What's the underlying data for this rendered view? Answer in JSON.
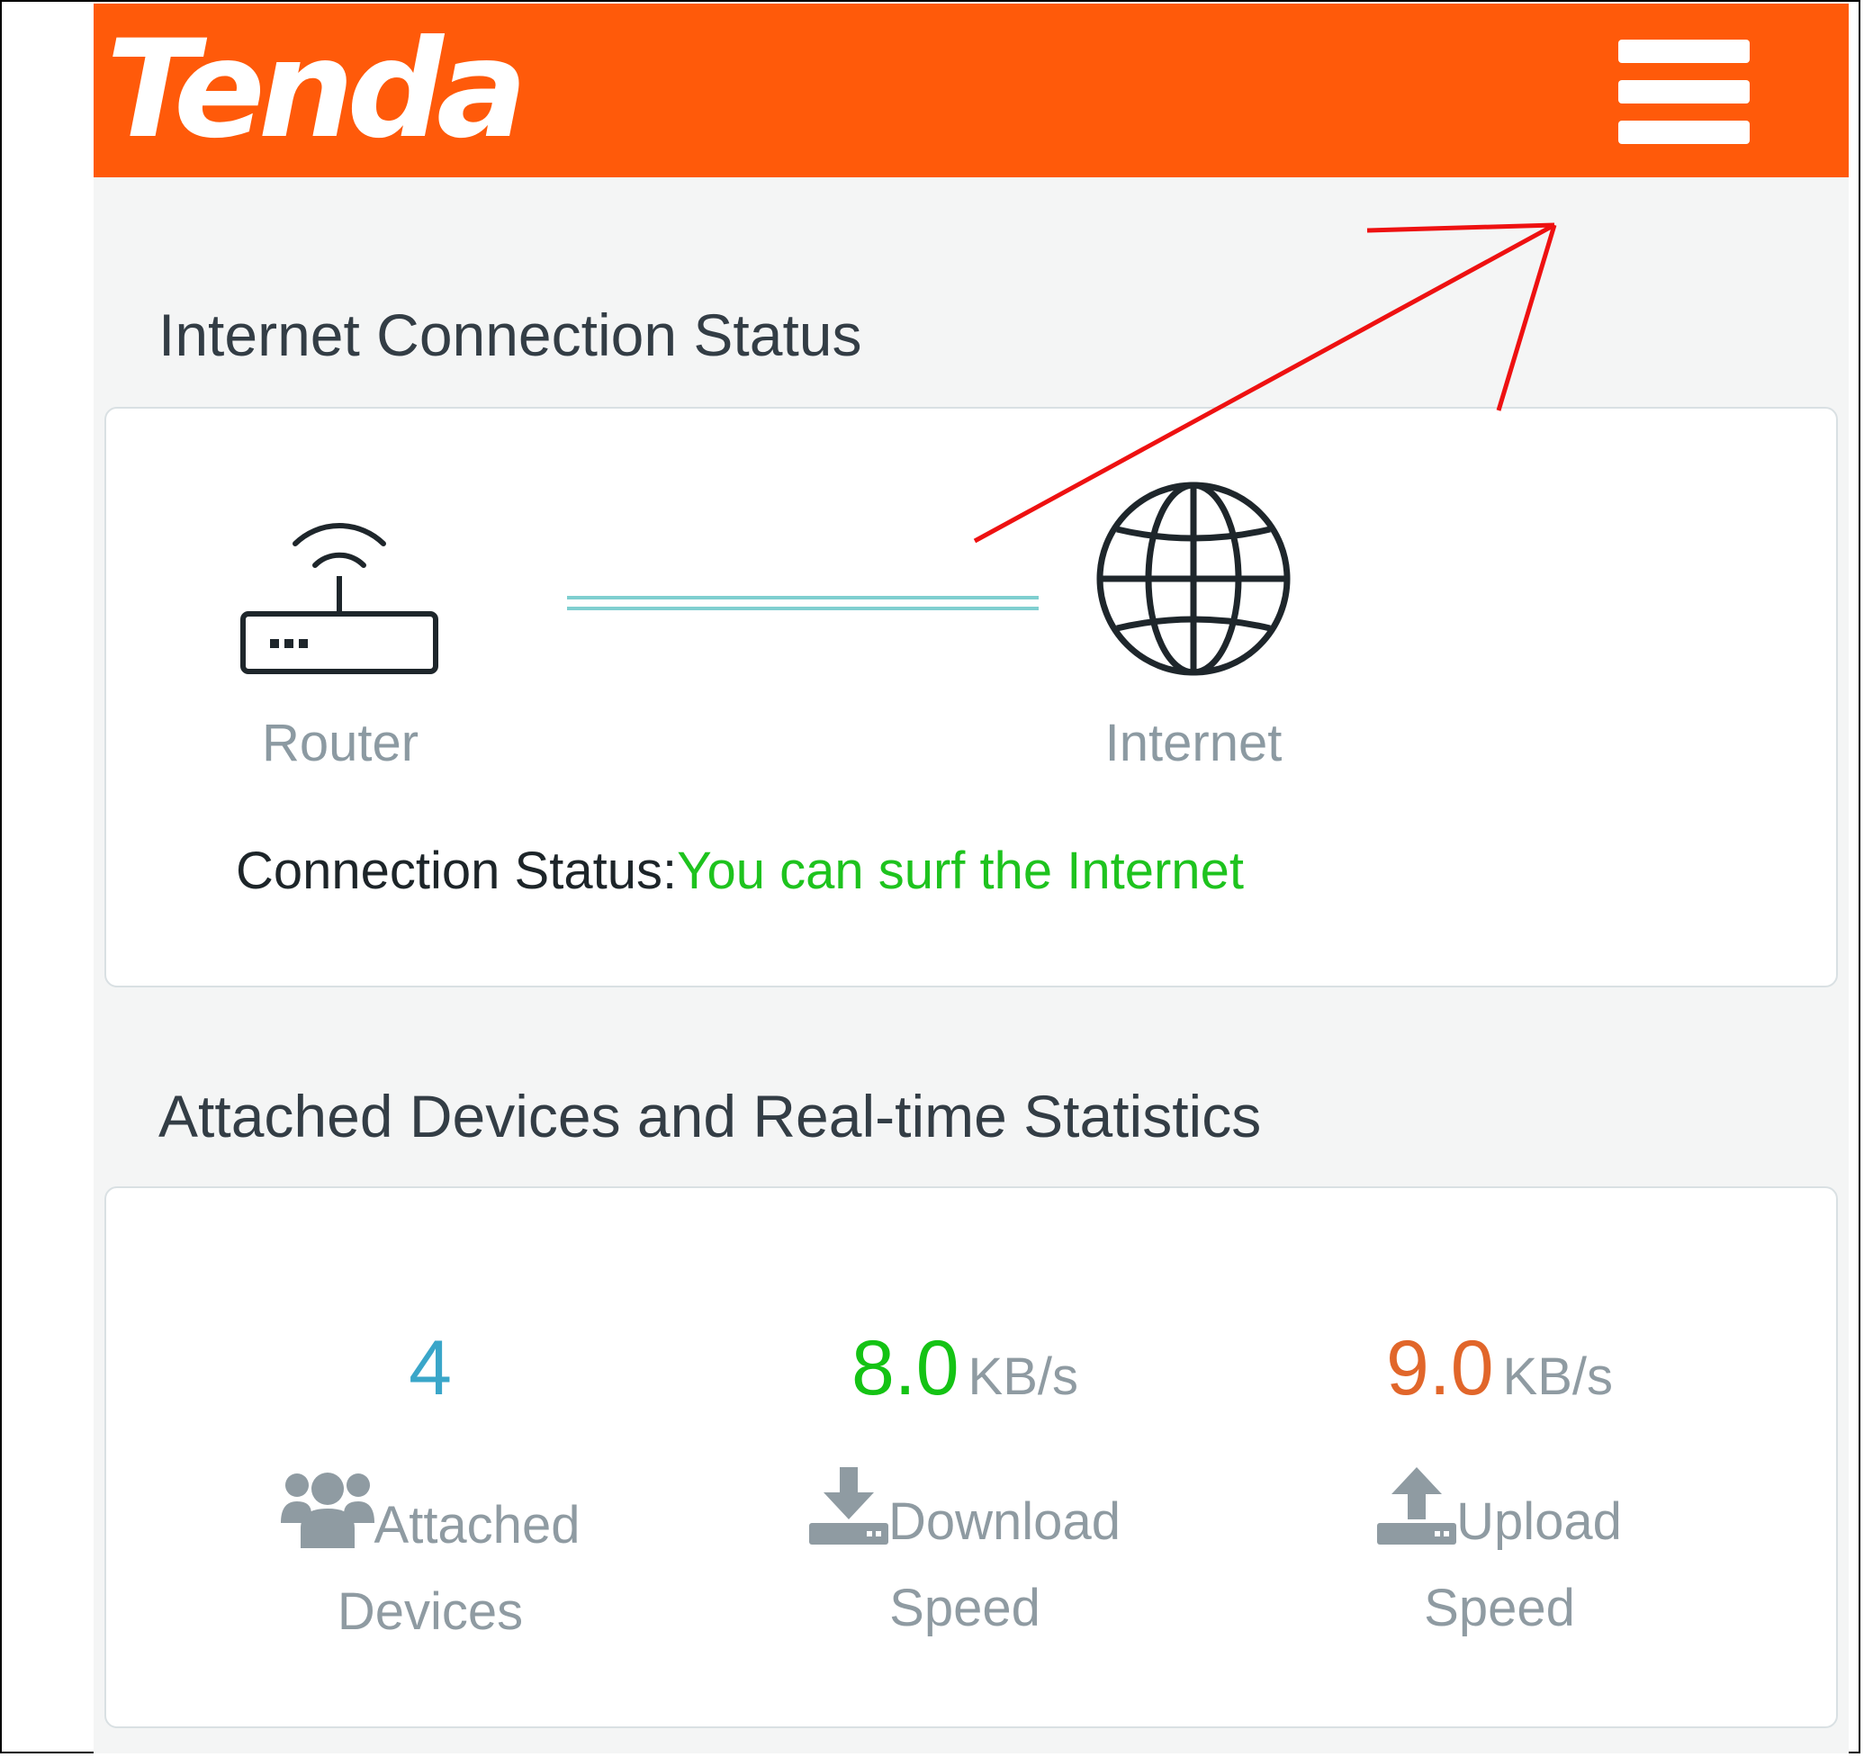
{
  "header": {
    "logo_text": "Tenda",
    "menu_icon": "hamburger-menu-icon",
    "brand_color": "#ff5a0a"
  },
  "internet_status": {
    "title": "Internet Connection Status",
    "router_label": "Router",
    "internet_label": "Internet",
    "connection_status_label": "Connection Status:",
    "connection_status_value": "You can surf the Internet",
    "status_color": "#1ec31e"
  },
  "statistics": {
    "title": "Attached Devices and Real-time Statistics",
    "attached_devices": {
      "value": "4",
      "label_line1": "Attached",
      "label_line2": "Devices",
      "icon": "users-icon",
      "color": "#3aa6c9"
    },
    "download": {
      "value": "8.0",
      "unit": "KB/s",
      "label_line1": "Download",
      "label_line2": "Speed",
      "icon": "download-icon",
      "color": "#14c314"
    },
    "upload": {
      "value": "9.0",
      "unit": "KB/s",
      "label_line1": "Upload",
      "label_line2": "Speed",
      "icon": "upload-icon",
      "color": "#e1662a"
    }
  },
  "annotation": {
    "arrow_color": "#ee1111",
    "icon": "red-arrow-annotation"
  }
}
